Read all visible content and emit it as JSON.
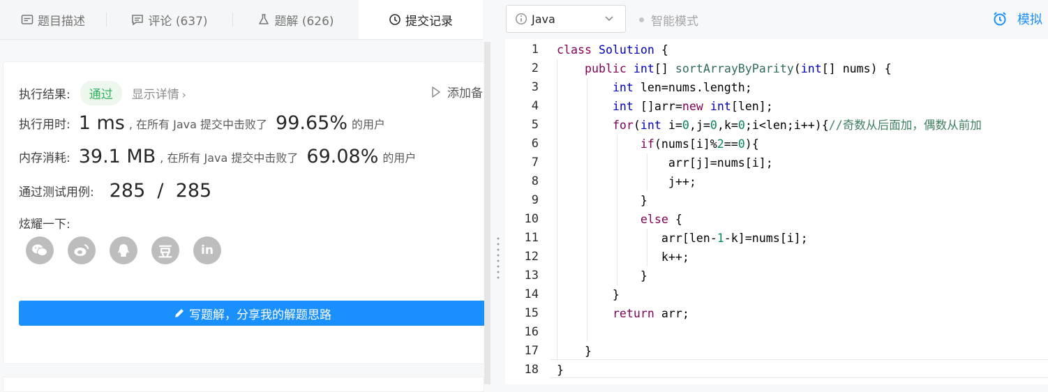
{
  "tabs": [
    {
      "label": "题目描述"
    },
    {
      "label": "评论 (637)"
    },
    {
      "label": "题解 (626)"
    },
    {
      "label": "提交记录"
    }
  ],
  "result": {
    "label": "执行结果:",
    "status": "通过",
    "detail_link": "显示详情",
    "add_note": "添加备"
  },
  "runtime": {
    "label": "执行用时:",
    "value": "1 ms",
    "mid": ", 在所有 Java 提交中击败了",
    "percent": "99.65%",
    "suffix": "的用户"
  },
  "memory": {
    "label": "内存消耗:",
    "value": "39.1 MB",
    "mid": ", 在所有 Java 提交中击败了",
    "percent": "69.08%",
    "suffix": "的用户"
  },
  "tests": {
    "label": "通过测试用例:",
    "value": "285  /  285"
  },
  "share": {
    "label": "炫耀一下:",
    "icons": [
      "wechat-icon",
      "weibo-icon",
      "qq-icon",
      "douban-icon",
      "linkedin-icon"
    ],
    "douban_glyph": "豆",
    "linkedin_glyph": "in"
  },
  "write_solution_button": "写题解，分享我的解题思路",
  "editor_toolbar": {
    "language": "Java",
    "mode": "智能模式",
    "simulate": "模拟"
  },
  "code": {
    "line_numbers": [
      "1",
      "2",
      "3",
      "4",
      "5",
      "6",
      "7",
      "8",
      "9",
      "10",
      "11",
      "12",
      "13",
      "14",
      "15",
      "16",
      "17",
      "18"
    ],
    "lines": [
      "class Solution {",
      "    public int[] sortArrayByParity(int[] nums) {",
      "        int len=nums.length;",
      "        int []arr=new int[len];",
      "        for(int i=0,j=0,k=0;i<len;i++){//奇数从后面加，偶数从前加",
      "            if(nums[i]%2==0){",
      "                arr[j]=nums[i];",
      "                j++;",
      "            }",
      "            else {",
      "               arr[len-1-k]=nums[i];",
      "               k++;",
      "            }",
      "        }",
      "        return arr;",
      "",
      "    }",
      "}"
    ]
  },
  "colors": {
    "accent": "#1a90ff",
    "success": "#2db55d",
    "keyword": "#7f0055",
    "type": "#0000c0",
    "comment": "#3f7f5f"
  }
}
